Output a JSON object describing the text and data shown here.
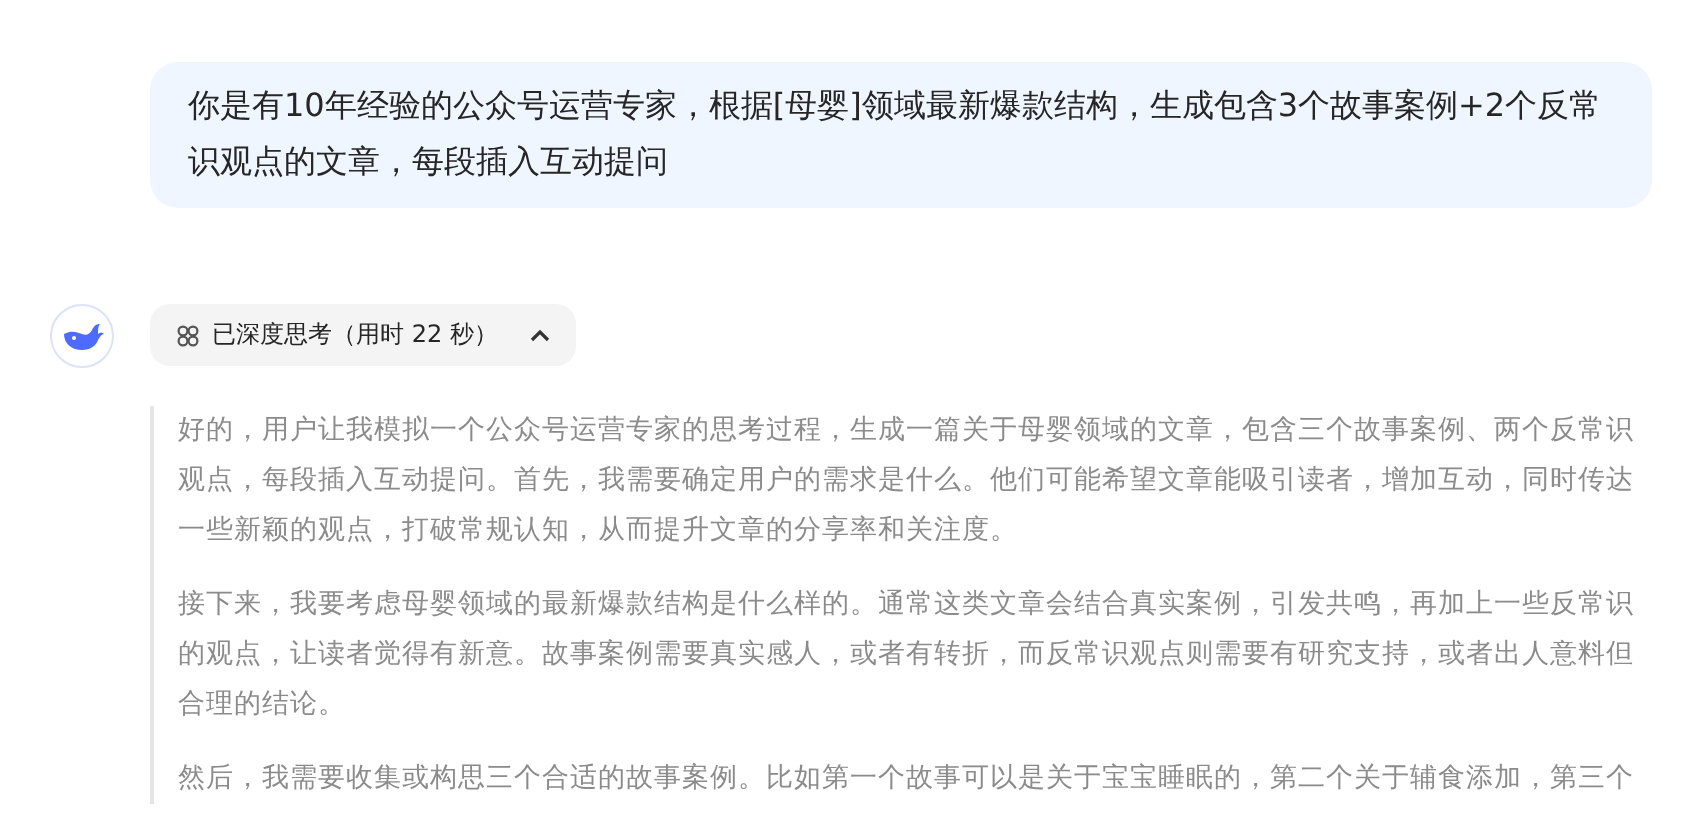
{
  "user_message": {
    "text": "你是有10年经验的公众号运营专家，根据[母婴]领域最新爆款结构，生成包含3个故事案例+2个反常识观点的文章，每段插入互动提问"
  },
  "thinking_toggle": {
    "label": "已深度思考（用时 22 秒）",
    "expanded": true
  },
  "thinking": {
    "paragraphs": [
      "好的，用户让我模拟一个公众号运营专家的思考过程，生成一篇关于母婴领域的文章，包含三个故事案例、两个反常识观点，每段插入互动提问。首先，我需要确定用户的需求是什么。他们可能希望文章能吸引读者，增加互动，同时传达一些新颖的观点，打破常规认知，从而提升文章的分享率和关注度。",
      "接下来，我要考虑母婴领域的最新爆款结构是什么样的。通常这类文章会结合真实案例，引发共鸣，再加上一些反常识的观点，让读者觉得有新意。故事案例需要真实感人，或者有转折，而反常识观点则需要有研究支持，或者出人意料但合理的结论。",
      "然后，我需要收集或构思三个合适的故事案例。比如第一个故事可以是关于宝宝睡眠的，第二个关于辅食添加，第三个"
    ]
  }
}
